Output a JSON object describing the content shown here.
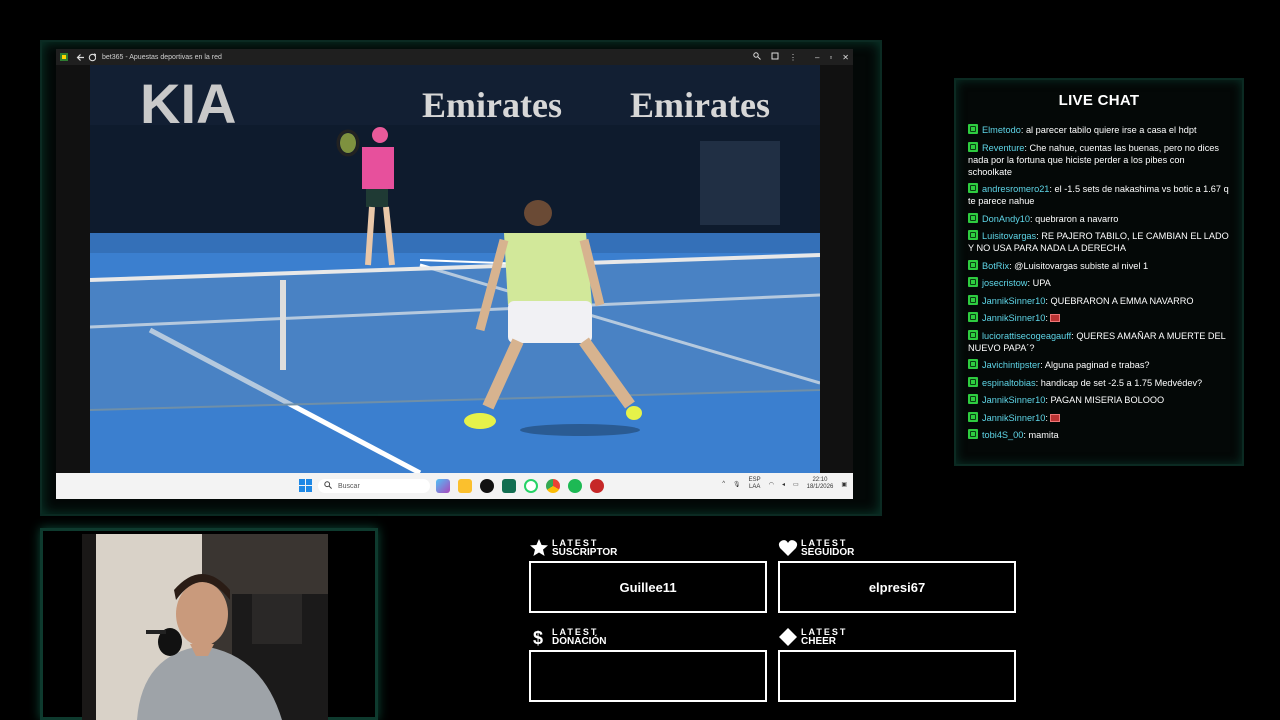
{
  "browser": {
    "title": "bet365 - Apuestas deportivas en la red"
  },
  "taskbar": {
    "search_placeholder": "Buscar",
    "lang_line1": "ESP",
    "lang_line2": "LAA",
    "time": "22:10",
    "date": "18/1/2026"
  },
  "chat": {
    "title": "LIVE CHAT",
    "messages": [
      {
        "user": "Elmetodo",
        "text": "al parecer tabilo quiere irse a casa el hdpt"
      },
      {
        "user": "Reventure",
        "text": "Che nahue, cuentas las buenas, pero no dices nada por la fortuna que hiciste perder a los pibes con schoolkate"
      },
      {
        "user": "andresromero21",
        "text": "el -1.5 sets de nakashima vs botic a 1.67 q te parece nahue"
      },
      {
        "user": "DonAndy10",
        "text": "quebraron a navarro"
      },
      {
        "user": "Luisitovargas",
        "text": "RE PAJERO TABILO, LE CAMBIAN EL LADO Y NO USA PARA NADA LA DERECHA"
      },
      {
        "user": "BotRix",
        "text": "@Luisitovargas subiste al nivel 1"
      },
      {
        "user": "josecristow",
        "text": "UPA"
      },
      {
        "user": "JannikSinner10",
        "text": "QUEBRARON A EMMA NAVARRO"
      },
      {
        "user": "JannikSinner10",
        "text": ""
      },
      {
        "user": "luciorattisecogeagauff",
        "text": "QUERES AMAÑAR A MUERTE DEL NUEVO PAPA´?"
      },
      {
        "user": "Javichintipster",
        "text": "Alguna paginad e trabas?"
      },
      {
        "user": "espinaltobias",
        "text": "handicap de set -2.5 a 1.75 Medvédev?"
      },
      {
        "user": "JannikSinner10",
        "text": "PAGAN MISERIA BOLOOO"
      },
      {
        "user": "JannikSinner10",
        "text": ""
      },
      {
        "user": "tobi4S_00",
        "text": "mamita"
      }
    ]
  },
  "scoreboard_ads": {
    "sponsor1": "KIA",
    "sponsor2": "Emirates",
    "sponsor3": "Emirates"
  },
  "widgets": {
    "latest_label": "LATEST",
    "subscriber": {
      "kind": "SUSCRIPTOR",
      "value": "Guillee11"
    },
    "follower": {
      "kind": "SEGUIDOR",
      "value": "elpresi67"
    },
    "donation": {
      "kind": "DONACIÓN",
      "value": ""
    },
    "cheer": {
      "kind": "CHEER",
      "value": ""
    }
  },
  "colors": {
    "accent_green": "#2ecc40",
    "username": "#5fd6e8",
    "frame_green": "#0e3a2e"
  }
}
